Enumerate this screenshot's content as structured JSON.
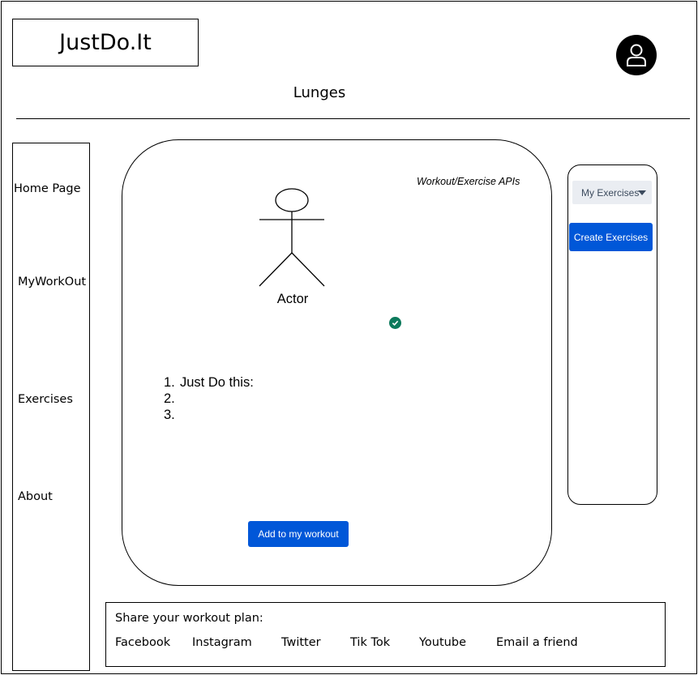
{
  "brand": {
    "logo_text": "JustDo.It"
  },
  "header": {
    "title": "Lunges",
    "avatar_icon": "user-icon"
  },
  "sidebar": {
    "items": [
      {
        "label": "Home Page"
      },
      {
        "label": "MyWorkOut"
      },
      {
        "label": "Exercises"
      },
      {
        "label": "About"
      }
    ]
  },
  "main": {
    "api_label": "Workout/Exercise APIs",
    "actor_label": "Actor",
    "status_icon": "check-circle-icon",
    "status_color": "#0c7a5c",
    "steps": [
      {
        "num": "1.",
        "text": "Just Do this:"
      },
      {
        "num": "2.",
        "text": ""
      },
      {
        "num": "3.",
        "text": ""
      }
    ],
    "add_button_label": "Add to my workout"
  },
  "right_panel": {
    "dropdown_value": "My Exercises",
    "create_button_label": "Create Exercises"
  },
  "footer": {
    "share_label": "Share your workout plan:",
    "links": [
      {
        "label": "Facebook"
      },
      {
        "label": "Instagram"
      },
      {
        "label": "Twitter"
      },
      {
        "label": "Tik Tok"
      },
      {
        "label": "Youtube"
      },
      {
        "label": "Email a friend"
      }
    ]
  },
  "colors": {
    "accent": "#0057d8",
    "dropdown_bg": "#eaedf2",
    "text": "#000000"
  }
}
